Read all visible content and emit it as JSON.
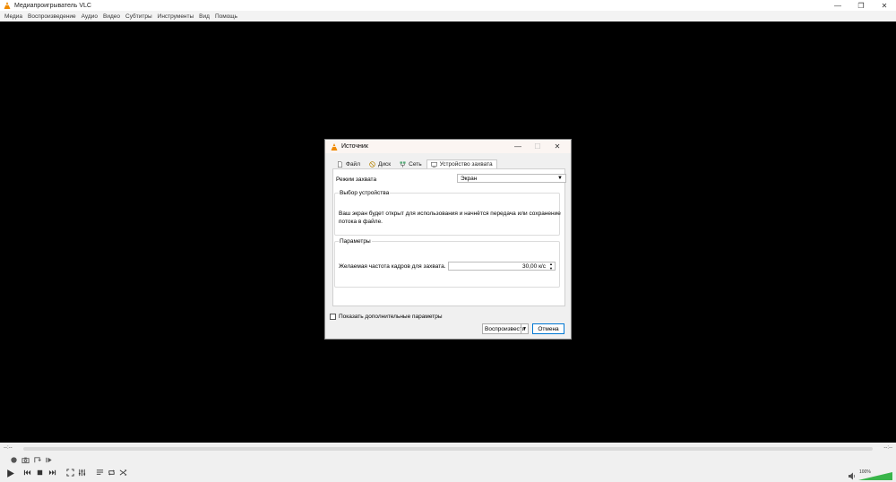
{
  "window": {
    "title": "Медиапроигрыватель VLC",
    "controls": [
      "—",
      "❐",
      "✕"
    ]
  },
  "menu": [
    "Медиа",
    "Воспроизведение",
    "Аудио",
    "Видео",
    "Субтитры",
    "Инструменты",
    "Вид",
    "Помощь"
  ],
  "dialog": {
    "title": "Источник",
    "controls": [
      "—",
      "☐",
      "✕"
    ],
    "tabs": [
      "Файл",
      "Диск",
      "Сеть",
      "Устройство захвата"
    ],
    "capture_mode_label": "Режим захвата",
    "capture_mode_value": "Экран",
    "device_group_label": "Выбор устройства",
    "device_description": "Ваш экран будет открыт для использования и начнётся передача или сохранение потока в файле.",
    "params_group_label": "Параметры",
    "fps_label": "Желаемая частота кадров для захвата.",
    "fps_value": "30,00 к/с",
    "advanced_label": "Показать дополнительные параметры",
    "play_button": "Воспроизвести",
    "cancel_button": "Отмена"
  },
  "player": {
    "time_elapsed": "--:--",
    "time_total": "--:--",
    "volume": "100%",
    "volume_level": 1.0
  }
}
